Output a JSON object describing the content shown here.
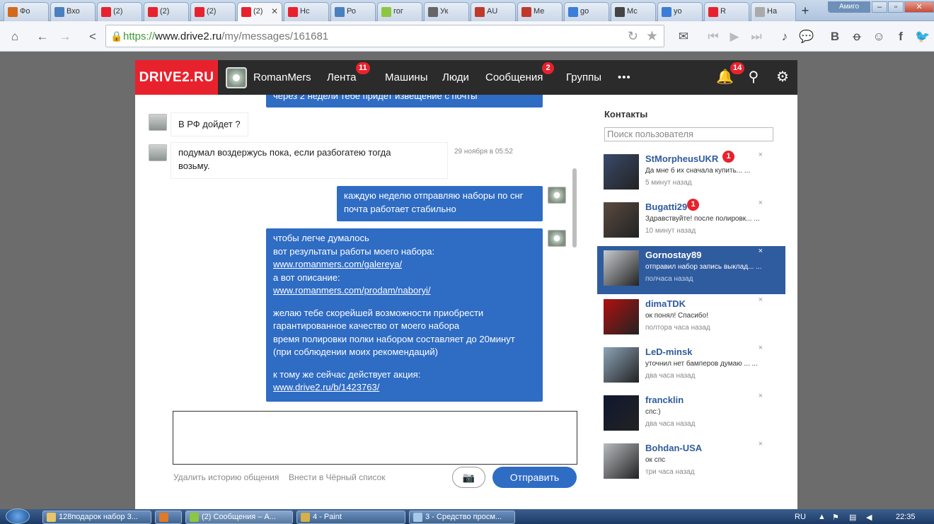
{
  "browser": {
    "tabs": [
      {
        "label": "Фо",
        "icon_color": "#d2691e"
      },
      {
        "label": "Вхо",
        "icon_color": "#4a7fc0"
      },
      {
        "label": "(2)",
        "icon_color": "#e8222d"
      },
      {
        "label": "(2)",
        "icon_color": "#e8222d"
      },
      {
        "label": "(2)",
        "icon_color": "#e8222d"
      },
      {
        "label": "(2)",
        "icon_color": "#e8222d"
      },
      {
        "label": "Нс",
        "icon_color": "#e8222d"
      },
      {
        "label": "Ро",
        "icon_color": "#4a7fc0"
      },
      {
        "label": "гог",
        "icon_color": "#8dc63f"
      },
      {
        "label": "Ук",
        "icon_color": "#666666"
      },
      {
        "label": "AU",
        "icon_color": "#c0392b"
      },
      {
        "label": "Ме",
        "icon_color": "#c0392b"
      },
      {
        "label": "go",
        "icon_color": "#3b7dd8"
      },
      {
        "label": "Мс",
        "icon_color": "#444444"
      },
      {
        "label": "yo",
        "icon_color": "#3b7dd8"
      },
      {
        "label": "R",
        "icon_color": "#e8222d"
      },
      {
        "label": "На",
        "icon_color": "#aaaaaa"
      }
    ],
    "new_tab": "+",
    "profile": "Амиго",
    "url_proto": "https://",
    "url_host": "www.drive2.ru",
    "url_path": "/my/messages/161681"
  },
  "site": {
    "logo": "DRIVE2.RU",
    "user": "RomanMers",
    "nav": {
      "feed": "Лента",
      "feed_badge": "11",
      "cars": "Машины",
      "people": "Люди",
      "messages": "Сообщения",
      "messages_badge": "2",
      "groups": "Группы",
      "more": "•••"
    },
    "notif_badge": "14"
  },
  "chat": {
    "top_cut": "через 2 недели тебе придет извещение с почты",
    "msg1": "В РФ дойдет ?",
    "msg2_l1": "подумал воздержусь пока, если разбогатею тогда",
    "msg2_l2": "возьму.",
    "msg2_time": "29 ноября в 05:52",
    "msg3_l1": "каждую неделю отправляю наборы по снг",
    "msg3_l2": "почта работает стабильно",
    "msg4_l1": "чтобы легче думалось",
    "msg4_l2": "вот результаты работы моего набора:",
    "msg4_link1": "www.romanmers.com/galereya/",
    "msg4_l3": "а вот описание:",
    "msg4_link2": "www.romanmers.com/prodam/naboryi/",
    "msg4_l4": "желаю тебе скорейшей возможности приобрести",
    "msg4_l5": "гарантированное качество от моего набора",
    "msg4_l6": "время полировки полки набором составляет до 20минут",
    "msg4_l7": "(при соблюдении моих рекомендаций)",
    "msg4_l8": "к тому же сейчас действует акция:",
    "msg4_link3": "www.drive2.ru/b/1423763/",
    "delete_history": "Удалить историю общения",
    "blacklist": "Внести в Чёрный список",
    "send": "Отправить"
  },
  "contacts": {
    "title": "Контакты",
    "search_placeholder": "Поиск пользователя",
    "items": [
      {
        "name": "StMorpheusUKR",
        "badge": "1",
        "preview": "Да мне б их сначала купить... ...",
        "time": "5 минут назад",
        "thumb": "#3a4a6a"
      },
      {
        "name": "Bugatti29",
        "badge": "1",
        "preview": "Здравствуйте! после полировк... ...",
        "time": "10 минут назад",
        "thumb": "#5a4a40"
      },
      {
        "name": "Gornostay89",
        "badge": "",
        "preview": "отправил набор запись выклад... ...",
        "time": "полчаса назад",
        "thumb": "#c8ccd0"
      },
      {
        "name": "dimaTDK",
        "badge": "",
        "preview": "ок понял! Спасибо!",
        "time": "полтора часа назад",
        "thumb": "#b01010"
      },
      {
        "name": "LeD-minsk",
        "badge": "",
        "preview": "уточнил нет бамперов думаю ... ...",
        "time": "два часа назад",
        "thumb": "#8da4b8"
      },
      {
        "name": "francklin",
        "badge": "",
        "preview": "спс:)",
        "time": "два часа назад",
        "thumb": "#101830"
      },
      {
        "name": "Bohdan-USA",
        "badge": "",
        "preview": "ок спс",
        "time": "три часа назад",
        "thumb": "#b8bcc0"
      }
    ]
  },
  "taskbar": {
    "t1": "128подарок набор 3...",
    "t2": "(2) Сообщения – А...",
    "t3": "4 - Paint",
    "t4": "3 - Средство просм...",
    "lang": "RU",
    "clock": "22:35"
  }
}
